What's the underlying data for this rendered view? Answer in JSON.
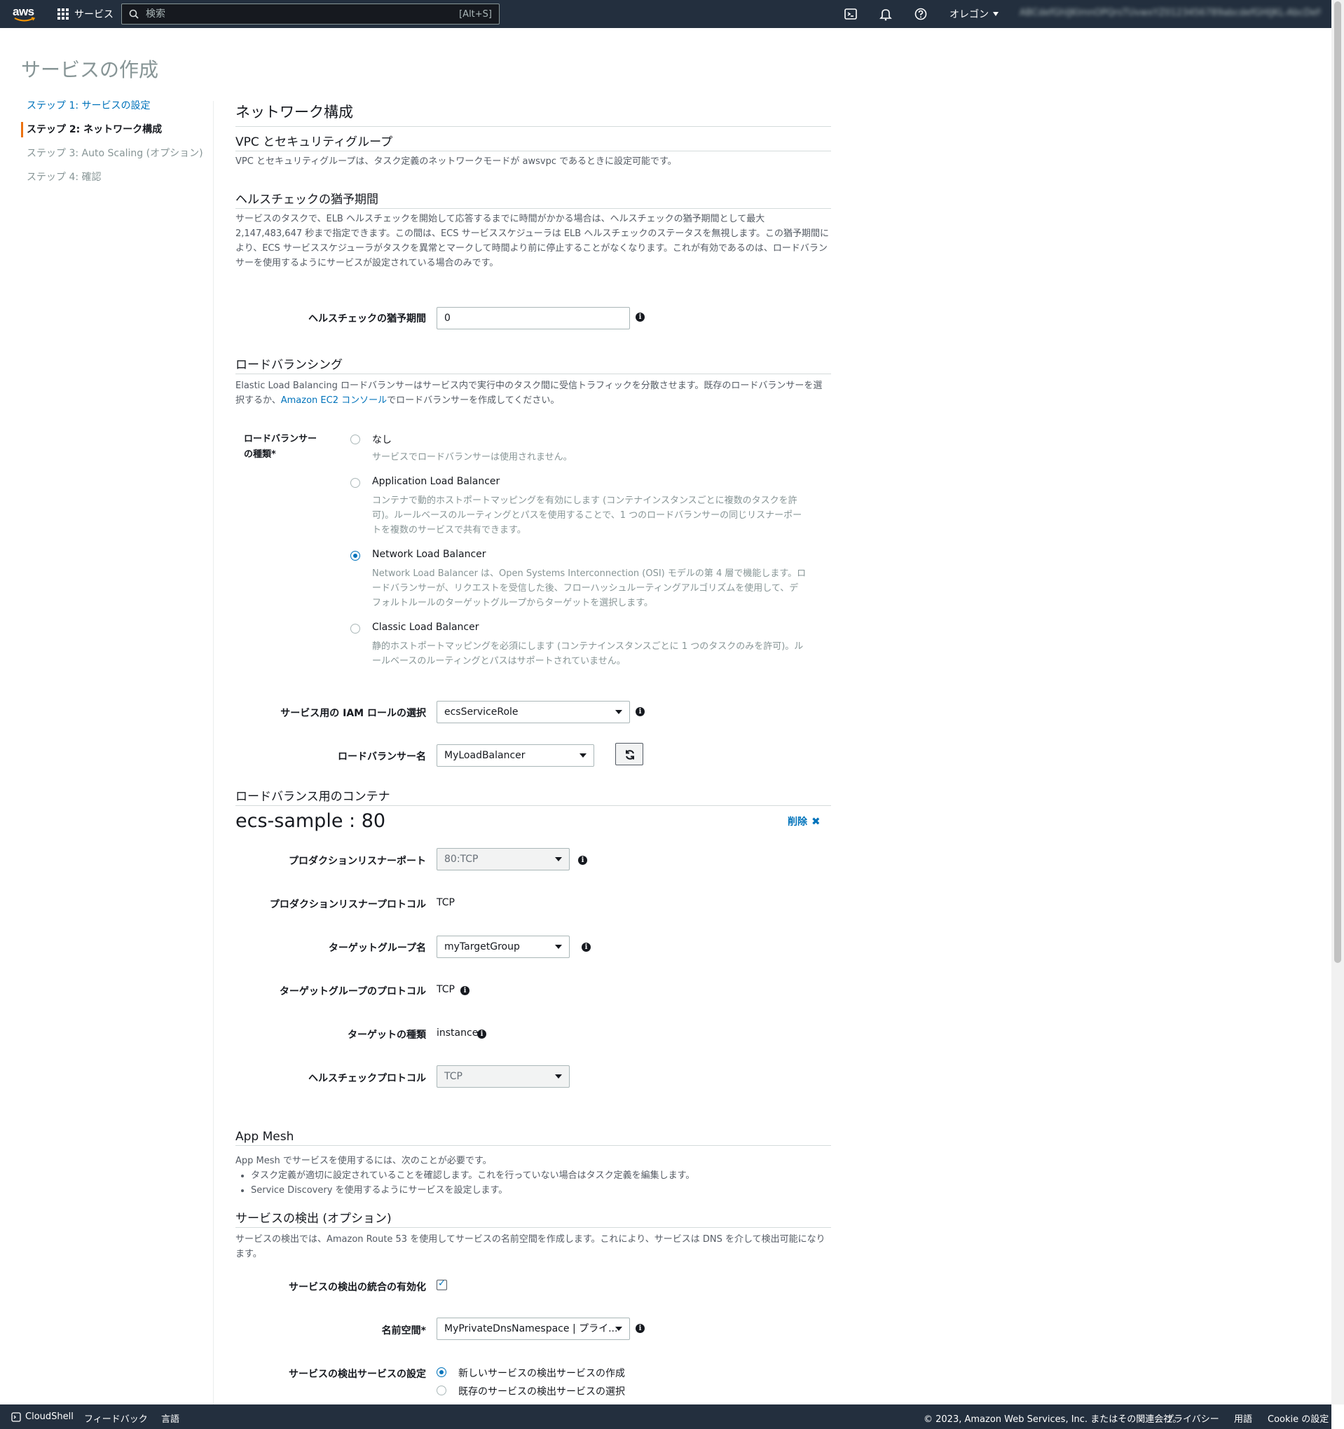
{
  "nav": {
    "logo": "aws",
    "services": "サービス",
    "search_placeholder": "検索",
    "search_shortcut": "[Alt+S]",
    "region": "オレゴン",
    "account": "ABCdefGhIJKlmnOPQrsTUvwxYZ0123456789abcdefGHIJKL-AbcDefGhijK"
  },
  "page": {
    "title": "サービスの作成"
  },
  "steps": [
    {
      "label": "ステップ 1: サービスの設定"
    },
    {
      "label": "ステップ 2: ネットワーク構成"
    },
    {
      "label": "ステップ 3: Auto Scaling (オプション)"
    },
    {
      "label": "ステップ 4: 確認"
    }
  ],
  "main": {
    "heading": "ネットワーク構成",
    "vpc": {
      "title": "VPC とセキュリティグループ",
      "desc": "VPC とセキュリティグループは、タスク定義のネットワークモードが awsvpc であるときに設定可能です。"
    },
    "health": {
      "title": "ヘルスチェックの猶予期間",
      "desc": "サービスのタスクで、ELB ヘルスチェックを開始して応答するまでに時間がかかる場合は、ヘルスチェックの猶予期間として最大 2,147,483,647 秒まで指定できます。この間は、ECS サービススケジューラは ELB ヘルスチェックのステータスを無視します。この猶予期間により、ECS サービススケジューラがタスクを異常とマークして時間より前に停止することがなくなります。これが有効であるのは、ロードバランサーを使用するようにサービスが設定されている場合のみです。",
      "field_label": "ヘルスチェックの猶予期間",
      "value": "0"
    },
    "lb": {
      "title": "ロードバランシング",
      "desc_before": "Elastic Load Balancing ロードバランサーはサービス内で実行中のタスク間に受信トラフィックを分散させます。既存のロードバランサーを選択するか、",
      "desc_link": "Amazon EC2 コンソール",
      "desc_after": "でロードバランサーを作成してください。",
      "type_label": "ロードバランサーの種類*",
      "options": [
        {
          "label": "なし",
          "desc": "サービスでロードバランサーは使用されません。"
        },
        {
          "label": "Application Load Balancer",
          "desc": "コンテナで動的ホストポートマッピングを有効にします (コンテナインスタンスごとに複数のタスクを許可)。ルールベースのルーティングとパスを使用することで、1 つのロードバランサーの同じリスナーポートを複数のサービスで共有できます。"
        },
        {
          "label": "Network Load Balancer",
          "desc": "Network Load Balancer は、Open Systems Interconnection (OSI) モデルの第 4 層で機能します。ロードバランサーが、リクエストを受信した後、フローハッシュルーティングアルゴリズムを使用して、デフォルトルールのターゲットグループからターゲットを選択します。"
        },
        {
          "label": "Classic Load Balancer",
          "desc": "静的ホストポートマッピングを必須にします (コンテナインスタンスごとに 1 つのタスクのみを許可)。ルールベースのルーティングとパスはサポートされていません。"
        }
      ],
      "selected": "Network Load Balancer",
      "iam_label": "サービス用の IAM ロールの選択",
      "iam_value": "ecsServiceRole",
      "lbname_label": "ロードバランサー名",
      "lbname_value": "MyLoadBalancer"
    },
    "container": {
      "title": "ロードバランス用のコンテナ",
      "name": "ecs-sample : 80",
      "remove": "削除",
      "listener_port_label": "プロダクションリスナーポート",
      "listener_port_value": "80:TCP",
      "listener_proto_label": "プロダクションリスナープロトコル",
      "listener_proto_value": "TCP",
      "tg_name_label": "ターゲットグループ名",
      "tg_name_value": "myTargetGroup",
      "tg_proto_label": "ターゲットグループのプロトコル",
      "tg_proto_value": "TCP",
      "target_type_label": "ターゲットの種類",
      "target_type_value": "instance",
      "hc_proto_label": "ヘルスチェックプロトコル",
      "hc_proto_value": "TCP"
    },
    "appmesh": {
      "title": "App Mesh",
      "desc": "App Mesh でサービスを使用するには、次のことが必要です。",
      "bullets": [
        "タスク定義が適切に設定されていることを確認します。これを行っていない場合はタスク定義を編集します。",
        "Service Discovery を使用するようにサービスを設定します。"
      ]
    },
    "sd": {
      "title": "サービスの検出 (オプション)",
      "desc": "サービスの検出では、Amazon Route 53 を使用してサービスの名前空間を作成します。これにより、サービスは DNS を介して検出可能になります。",
      "enable_label": "サービスの検出の統合の有効化",
      "namespace_label": "名前空間*",
      "namespace_value": "MyPrivateDnsNamespace | プライ...",
      "service_label": "サービスの検出サービスの設定",
      "service_options": [
        "新しいサービスの検出サービスの作成",
        "既存のサービスの検出サービスの選択"
      ]
    }
  },
  "footer": {
    "cloudshell": "CloudShell",
    "feedback": "フィードバック",
    "language": "言語",
    "copyright": "© 2023, Amazon Web Services, Inc. またはその関連会社。",
    "privacy": "プライバシー",
    "terms": "用語",
    "cookie": "Cookie の設定"
  }
}
